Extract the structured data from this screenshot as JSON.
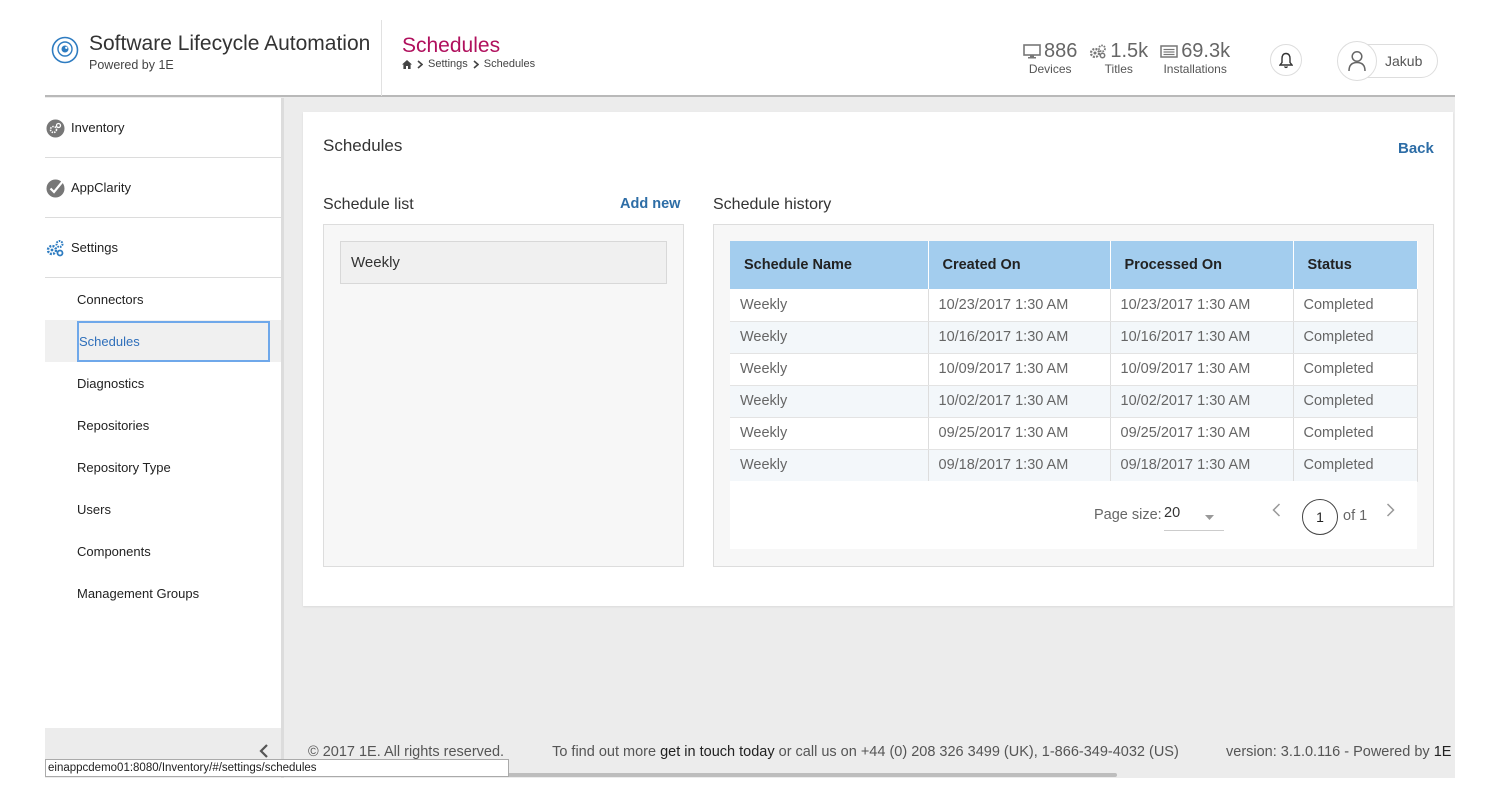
{
  "header": {
    "app_title": "Software Lifecycle Automation",
    "app_subtitle": "Powered by 1E",
    "page_title": "Schedules",
    "breadcrumb": [
      "Settings",
      "Schedules"
    ],
    "stats": [
      {
        "icon": "monitor-icon",
        "value": "886",
        "label": "Devices"
      },
      {
        "icon": "gears-icon",
        "value": "1.5k",
        "label": "Titles"
      },
      {
        "icon": "installations-icon",
        "value": "69.3k",
        "label": "Installations"
      }
    ],
    "user_name": "Jakub"
  },
  "sidebar": {
    "main_items": [
      {
        "icon": "inventory-icon",
        "label": "Inventory"
      },
      {
        "icon": "appclarity-icon",
        "label": "AppClarity"
      },
      {
        "icon": "settings-gears-icon",
        "label": "Settings"
      }
    ],
    "sub_items": [
      {
        "label": "Connectors",
        "active": false
      },
      {
        "label": "Schedules",
        "active": true
      },
      {
        "label": "Diagnostics",
        "active": false
      },
      {
        "label": "Repositories",
        "active": false
      },
      {
        "label": "Repository Type",
        "active": false
      },
      {
        "label": "Users",
        "active": false
      },
      {
        "label": "Components",
        "active": false
      },
      {
        "label": "Management Groups",
        "active": false
      }
    ]
  },
  "main": {
    "title": "Schedules",
    "back_label": "Back",
    "schedule_list": {
      "title": "Schedule list",
      "add_new_label": "Add new",
      "items": [
        "Weekly"
      ]
    },
    "schedule_history": {
      "title": "Schedule history",
      "columns": [
        "Schedule Name",
        "Created On",
        "Processed On",
        "Status"
      ],
      "rows": [
        [
          "Weekly",
          "10/23/2017 1:30 AM",
          "10/23/2017 1:30 AM",
          "Completed"
        ],
        [
          "Weekly",
          "10/16/2017 1:30 AM",
          "10/16/2017 1:30 AM",
          "Completed"
        ],
        [
          "Weekly",
          "10/09/2017 1:30 AM",
          "10/09/2017 1:30 AM",
          "Completed"
        ],
        [
          "Weekly",
          "10/02/2017 1:30 AM",
          "10/02/2017 1:30 AM",
          "Completed"
        ],
        [
          "Weekly",
          "09/25/2017 1:30 AM",
          "09/25/2017 1:30 AM",
          "Completed"
        ],
        [
          "Weekly",
          "09/18/2017 1:30 AM",
          "09/18/2017 1:30 AM",
          "Completed"
        ]
      ],
      "pager": {
        "page_size_label": "Page size:",
        "page_size": "20",
        "current_page": "1",
        "of_label": "of 1"
      }
    }
  },
  "footer": {
    "copyright": "© 2017 1E. All rights reserved.",
    "find_out": "To find out more",
    "link": "get in touch today",
    "call": "or call us on +44 (0) 208 326 3499 (UK), 1-866-349-4032 (US)",
    "version": "version: 3.1.0.116 - Powered by",
    "brand": "1E"
  },
  "status_url": "einappcdemo01:8080/Inventory/#/settings/schedules",
  "colors": {
    "accent_title": "#b0105d",
    "link": "#2d6da6",
    "table_header": "#a3cdee",
    "active_border": "#6fa8ea"
  }
}
